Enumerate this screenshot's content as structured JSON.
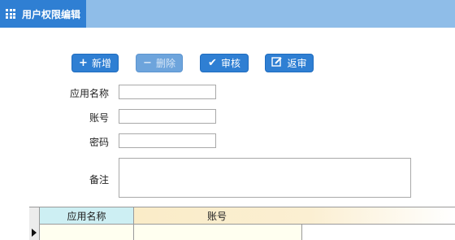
{
  "tab": {
    "title": "用户权限编辑",
    "icon": "grid-icon"
  },
  "toolbar": {
    "add_label": "新增",
    "delete_label": "删除",
    "approve_label": "审核",
    "reject_label": "返审"
  },
  "form": {
    "app_name_label": "应用名称",
    "app_name_value": "",
    "account_label": "账号",
    "account_value": "",
    "password_label": "密码",
    "password_value": "",
    "remark_label": "备注",
    "remark_value": ""
  },
  "table": {
    "columns": [
      "应用名称",
      "账号"
    ],
    "rows": [
      [
        "",
        ""
      ]
    ]
  },
  "colors": {
    "accent": "#2f7fd3",
    "titlebar": "#8fbde8"
  }
}
